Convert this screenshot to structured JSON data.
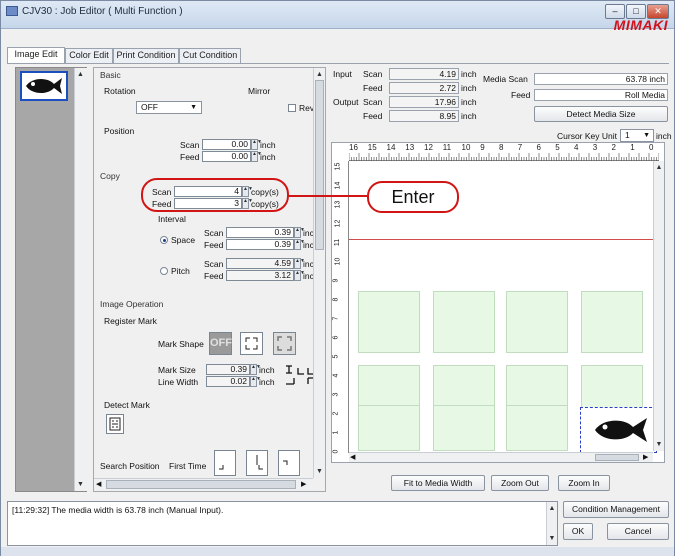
{
  "window": {
    "title": "CJV30 : Job Editor ( Multi Function )",
    "logo": "MIMAKI",
    "controls": [
      "–",
      "□",
      "✕"
    ]
  },
  "tabs": [
    "Image Edit",
    "Color Edit",
    "Print Condition",
    "Cut Condition"
  ],
  "basic": {
    "section": "Basic",
    "rotation_label": "Rotation",
    "rotation_value": "OFF",
    "mirror_label": "Mirror",
    "mirror_check_label": "Rev",
    "position_label": "Position",
    "pos_scan_label": "Scan",
    "pos_scan_value": "0.00",
    "pos_feed_label": "Feed",
    "pos_feed_value": "0.00",
    "unit_inch": "inch"
  },
  "copy": {
    "section": "Copy",
    "scan_label": "Scan",
    "scan_value": "4",
    "feed_label": "Feed",
    "feed_value": "3",
    "unit": "copy(s)",
    "interval_label": "Interval",
    "space_label": "Space",
    "space_scan": "0.39",
    "space_feed": "0.39",
    "pitch_label": "Pitch",
    "pitch_scan": "4.59",
    "pitch_feed": "3.12",
    "unit_short": "inch"
  },
  "image_operation": {
    "section": "Image Operation",
    "register_mark": "Register Mark",
    "mark_shape": "Mark Shape",
    "off_label": "OFF",
    "mark_size_label": "Mark Size",
    "mark_size_value": "0.39",
    "line_width_label": "Line Width",
    "line_width_value": "0.02",
    "detect_mark": "Detect Mark",
    "search_position": "Search Position",
    "first_time": "First Time"
  },
  "info": {
    "input_label": "Input",
    "output_label": "Output",
    "scan_label": "Scan",
    "feed_label": "Feed",
    "input_scan": "4.19",
    "input_feed": "2.72",
    "output_scan": "17.96",
    "output_feed": "8.95",
    "unit": "inch"
  },
  "media": {
    "scan_label": "Media Scan",
    "scan_value": "63.78 inch",
    "feed_label": "Feed",
    "feed_value": "Roll Media",
    "detect_button": "Detect Media Size",
    "cursor_key_unit_label": "Cursor Key Unit",
    "cursor_key_unit_value": "1",
    "cursor_unit": "inch"
  },
  "ruler": {
    "h_numbers": [
      "16",
      "15",
      "14",
      "13",
      "12",
      "11",
      "10",
      "9",
      "8",
      "7",
      "6",
      "5",
      "4",
      "3",
      "2",
      "1",
      "0"
    ],
    "v_numbers": [
      "15",
      "14",
      "13",
      "12",
      "11",
      "10",
      "9",
      "8",
      "7",
      "6",
      "5",
      "4",
      "3",
      "2",
      "1",
      "0"
    ]
  },
  "view_buttons": {
    "fit": "Fit to Media Width",
    "zoom_out": "Zoom Out",
    "zoom_in": "Zoom In"
  },
  "log": {
    "message": "[11:29:32] The media width is 63.78 inch (Manual Input)."
  },
  "bottom_buttons": {
    "condition_management": "Condition Management",
    "ok": "OK",
    "cancel": "Cancel"
  },
  "annotation": {
    "enter": "Enter"
  },
  "colors": {
    "accent": "#d11515",
    "selection_border": "#2a3fc4",
    "cell_fill": "#e7f9e4"
  }
}
